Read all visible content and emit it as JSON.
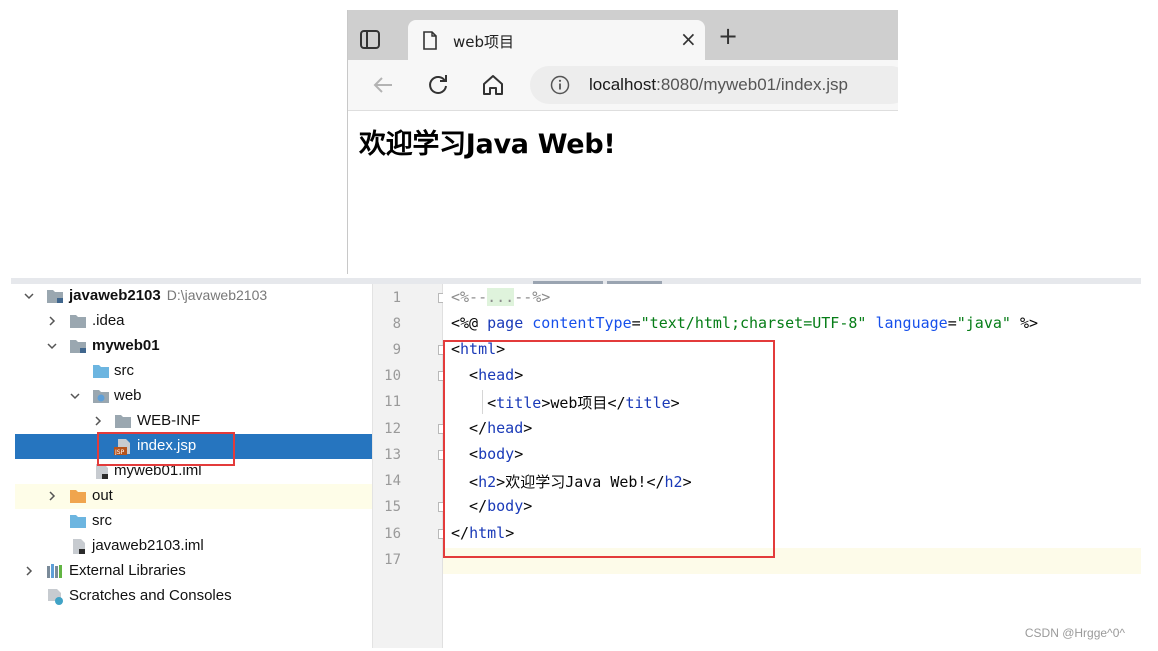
{
  "browser": {
    "tab_title": "web项目",
    "close_glyph": "×",
    "new_tab_glyph": "+",
    "url_host": "localhost",
    "url_rest": ":8080/myweb01/index.jsp",
    "page_heading": "欢迎学习Java Web!"
  },
  "project": {
    "items": [
      {
        "label": "javaweb2103",
        "path": "D:\\javaweb2103"
      },
      {
        "label": ".idea"
      },
      {
        "label": "myweb01"
      },
      {
        "label": "src"
      },
      {
        "label": "web"
      },
      {
        "label": "WEB-INF"
      },
      {
        "label": "index.jsp"
      },
      {
        "label": "myweb01.iml"
      },
      {
        "label": "out"
      },
      {
        "label": "src"
      },
      {
        "label": "javaweb2103.iml"
      },
      {
        "label": "External Libraries"
      },
      {
        "label": "Scratches and Consoles"
      }
    ]
  },
  "editor": {
    "line_numbers": [
      "1",
      "8",
      "9",
      "10",
      "11",
      "12",
      "13",
      "14",
      "15",
      "16",
      "17"
    ],
    "tokens": {
      "comment_open": "<%--",
      "comment_dots": "...",
      "comment_close": "--%>",
      "directive_open": "<%@ ",
      "page_kw": "page",
      "content_type_attr": "contentType",
      "content_type_val": "\"text/html;charset=UTF-8\"",
      "language_attr": "language",
      "language_val": "\"java\"",
      "directive_close": " %>",
      "html": "html",
      "head": "head",
      "title": "title",
      "title_text": "web项目",
      "body": "body",
      "h2": "h2",
      "h2_text": "欢迎学习Java Web!"
    }
  },
  "watermark": "CSDN @Hrgge^0^",
  "colors": {
    "selection": "#2675bf",
    "highlight_box": "#e33b3b",
    "tag_keyword": "#1a3ab8",
    "string": "#067d17"
  }
}
